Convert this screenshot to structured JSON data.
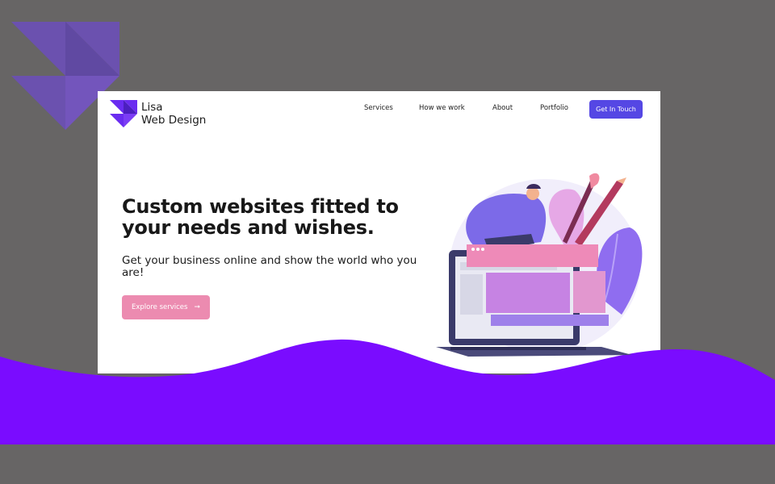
{
  "logo": {
    "line1": "Lisa",
    "line2": "Web Design",
    "mark_icon": "triangle-grid-logo-icon"
  },
  "nav": {
    "items": [
      {
        "label": "Services"
      },
      {
        "label": "How we work"
      },
      {
        "label": "About"
      },
      {
        "label": "Portfolio"
      }
    ],
    "cta_label": "Get In Touch"
  },
  "hero": {
    "title": "Custom websites fitted to your needs and wishes.",
    "subtitle": "Get your business online and show the world who you are!",
    "button_label": "Explore services",
    "button_icon": "arrow-right-icon"
  },
  "illustration": {
    "icon": "web-designer-laptop-illustration"
  },
  "colors": {
    "background": "#676565",
    "card": "#ffffff",
    "accent_purple": "#7a0cff",
    "brand_indigo": "#5547e4",
    "button_pink": "#ec8bb0",
    "logo_purple": "#6a2cf0"
  }
}
